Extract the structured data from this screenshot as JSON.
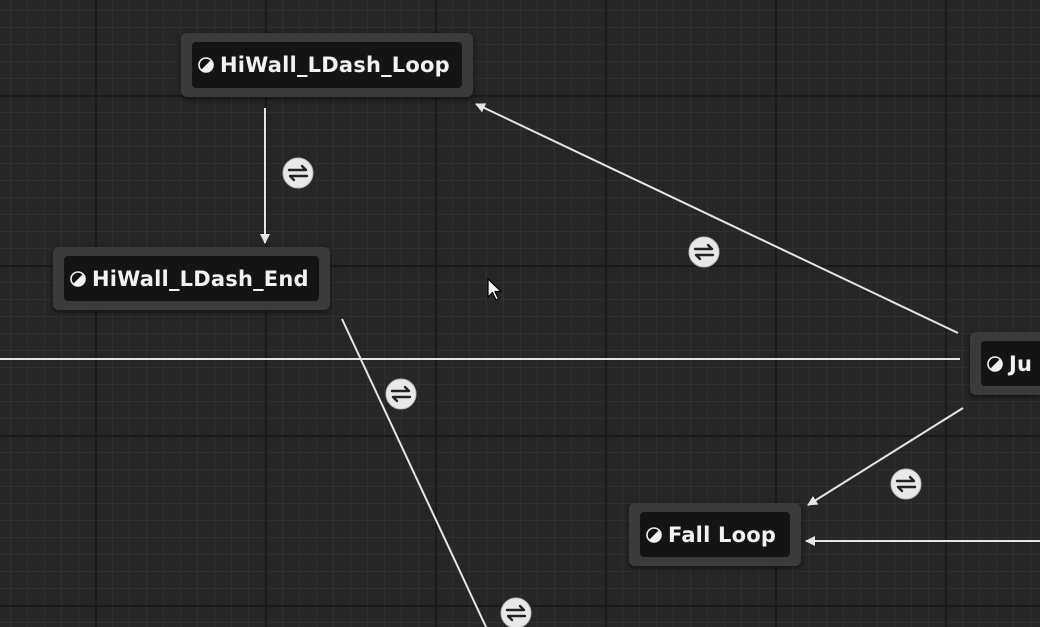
{
  "graph": {
    "states": [
      {
        "id": "hiwall-ldash-loop",
        "label": "HiWall_LDash_Loop",
        "icon": "state-machine-icon"
      },
      {
        "id": "hiwall-ldash-end",
        "label": "HiWall_LDash_End",
        "icon": "state-machine-icon"
      },
      {
        "id": "jump-partial",
        "label": "Ju",
        "icon": "state-machine-icon"
      },
      {
        "id": "fall-loop",
        "label": "Fall Loop",
        "icon": "state-machine-icon"
      }
    ],
    "transitions": [
      {
        "from": "HiWall_LDash_Loop",
        "to": "HiWall_LDash_End",
        "icon": "transition-rule-icon"
      },
      {
        "from": "Ju",
        "to": "HiWall_LDash_Loop",
        "icon": "transition-rule-icon"
      },
      {
        "from": "HiWall_LDash_End",
        "to": "offscreen",
        "icon": "transition-rule-icon"
      },
      {
        "from": "Ju",
        "to": "Fall Loop",
        "icon": "transition-rule-icon"
      },
      {
        "from": "offscreen",
        "to": "Fall Loop",
        "icon": "none"
      }
    ]
  },
  "colors": {
    "background": "#262626",
    "node_body": "#3b3b3b",
    "node_title": "#141414",
    "wire": "#e6e6e6",
    "text": "#f2f2f2"
  }
}
